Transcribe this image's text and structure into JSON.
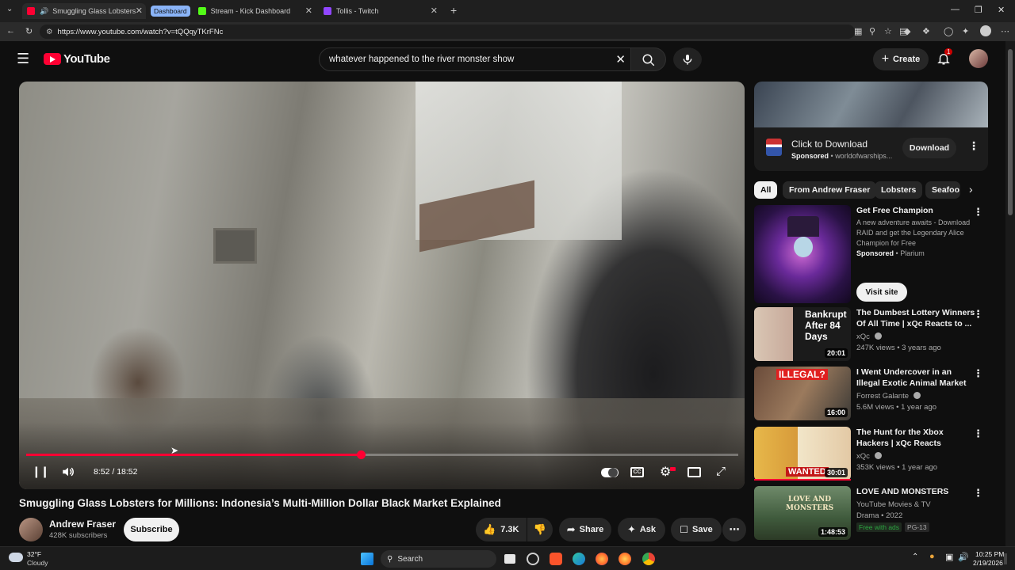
{
  "browser": {
    "tabs": [
      {
        "title": "Smuggling Glass Lobsters for",
        "favicon_color": "#ff0033"
      },
      {
        "group": "Dashboard",
        "title": "Stream - Kick Dashboard",
        "favicon_color": "#53fc18"
      },
      {
        "title": "Tollis - Twitch",
        "favicon_color": "#9146ff"
      }
    ],
    "url": "https://www.youtube.com/watch?v=tQQqyTKrFNc"
  },
  "header": {
    "logo_text": "YouTube",
    "search_query": "whatever happened to the river monster show",
    "create_label": "Create",
    "notification_count": "1"
  },
  "player": {
    "time_display": "8:52 / 18:52",
    "progress_fraction": 0.47
  },
  "video": {
    "title": "Smuggling Glass Lobsters for Millions: Indonesia’s Multi-Million Dollar Black Market Explained",
    "channel_name": "Andrew Fraser",
    "subscribers": "428K subscribers",
    "subscribe_label": "Subscribe",
    "likes": "7.3K",
    "share_label": "Share",
    "ask_label": "Ask",
    "save_label": "Save"
  },
  "sidebar": {
    "ad": {
      "title": "Click to Download",
      "sponsored": "Sponsored",
      "domain": "worldofwarships...",
      "cta": "Download"
    },
    "chips": [
      "All",
      "From Andrew Fraser",
      "Lobsters",
      "Seafoo"
    ],
    "recs": [
      {
        "title": "Get Free Champion",
        "desc": "A new adventure awaits - Download RAID and get the Legendary Alice Champion for Free",
        "sponsored": "Sponsored",
        "advertiser": "Plarium",
        "cta": "Visit site"
      },
      {
        "title": "The Dumbest Lottery Winners Of All Time | xQc Reacts to ...",
        "channel": "xQc",
        "meta": "247K views • 3 years ago",
        "duration": "20:01",
        "thumb_text": "Bankrupt After 84 Days"
      },
      {
        "title": "I Went Undercover in an Illegal Exotic Animal Market",
        "channel": "Forrest Galante",
        "meta": "5.6M views • 1 year ago",
        "duration": "16:00",
        "thumb_text": "ILLEGAL?"
      },
      {
        "title": "The Hunt for the Xbox Hackers | xQc Reacts",
        "channel": "xQc",
        "meta": "353K views • 1 year ago",
        "duration": "30:01",
        "thumb_text": "WANTED"
      },
      {
        "title": "LOVE AND MONSTERS",
        "channel": "YouTube Movies & TV",
        "meta": "Drama • 2022",
        "free_label": "Free with ads",
        "rating": "PG-13",
        "duration": "1:48:53",
        "thumb_text": "LOVE AND MONSTERS"
      }
    ]
  },
  "taskbar": {
    "weather_temp": "32°F",
    "weather_desc": "Cloudy",
    "search_label": "Search",
    "time": "10:25 PM",
    "date": "2/19/2026"
  },
  "colors": {
    "accent": "#ff0033",
    "background": "#0f0f0f",
    "verified": "#aaaaaa",
    "free_green": "#2ba640"
  }
}
